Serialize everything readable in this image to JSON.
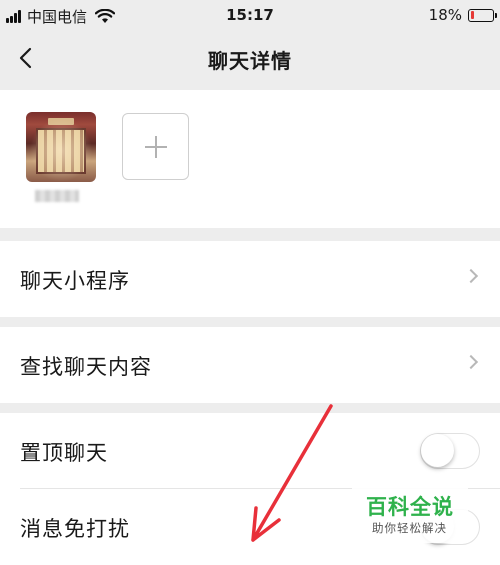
{
  "status_bar": {
    "carrier": "中国电信",
    "time": "15:17",
    "battery_percent": "18%",
    "battery_level": 0.18,
    "battery_color": "#e53935",
    "signal_icon": "signal-bars-icon",
    "wifi_icon": "wifi-icon"
  },
  "nav": {
    "title": "聊天详情",
    "back_icon": "chevron-left-icon"
  },
  "members": {
    "add_icon": "plus-icon"
  },
  "menu": {
    "mini_programs": "聊天小程序",
    "search_history": "查找聊天内容",
    "sticky_on_top": "置顶聊天",
    "mute_notifications": "消息免打扰"
  },
  "toggles": {
    "sticky_on_top": false,
    "mute_notifications": false
  },
  "watermark": {
    "title": "百科全说",
    "subtitle": "助你轻松解决"
  },
  "annotation": {
    "arrow_color": "#e8303a"
  }
}
